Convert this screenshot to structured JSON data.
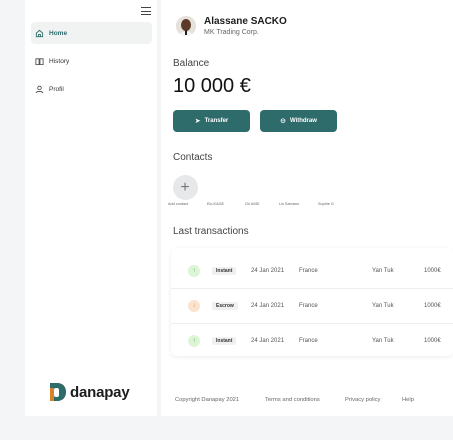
{
  "sidebar": {
    "items": [
      {
        "label": "Home",
        "icon": "home-icon",
        "active": true
      },
      {
        "label": "History",
        "icon": "book-icon",
        "active": false
      },
      {
        "label": "Profil",
        "icon": "user-icon",
        "active": false
      }
    ],
    "logo_text": "danapay"
  },
  "user": {
    "name": "Alassane SACKO",
    "company": "MK Trading Corp."
  },
  "balance": {
    "label": "Balance",
    "value": "10 000 €"
  },
  "actions": {
    "transfer_label": "Transfer",
    "withdraw_label": "Withdraw"
  },
  "contacts": {
    "title": "Contacts",
    "add_label": "Add contact",
    "items": [
      "Elo KAGE",
      "Ori AMD",
      "Lis Samano",
      "Sophie G"
    ]
  },
  "transactions": {
    "title": "Last transactions",
    "rows": [
      {
        "direction": "up",
        "type": "Instant",
        "date": "24 Jan 2021",
        "country": "France",
        "name": "Yan Tuk",
        "amount": "1000€"
      },
      {
        "direction": "down",
        "type": "Escrow",
        "date": "24 Jan 2021",
        "country": "France",
        "name": "Yan Tuk",
        "amount": "1000€"
      },
      {
        "direction": "up",
        "type": "Instant",
        "date": "24 Jan 2021",
        "country": "France",
        "name": "Yan Tuk",
        "amount": "1000€"
      }
    ]
  },
  "footer": {
    "copyright": "Copyright Danapay 2021",
    "terms": "Terms and conditions",
    "privacy": "Privacy policy",
    "help": "Help"
  },
  "colors": {
    "accent": "#2e6b6b",
    "incoming": "#3aa04a",
    "outgoing": "#d9822b"
  }
}
